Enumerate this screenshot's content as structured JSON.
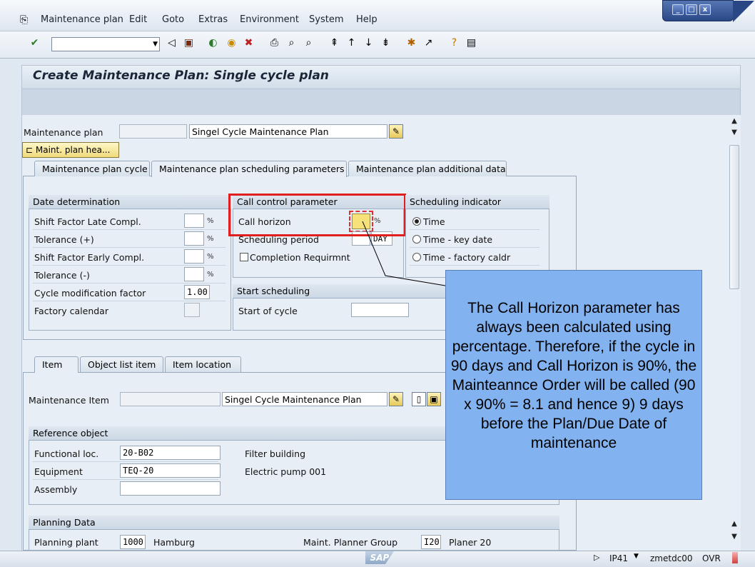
{
  "menu": {
    "items": [
      "Maintenance plan",
      "Edit",
      "Goto",
      "Extras",
      "Environment",
      "System",
      "Help"
    ]
  },
  "window_controls": {
    "minimize": "_",
    "maximize": "□",
    "close": "x"
  },
  "toolbar": {
    "command_value": ""
  },
  "header": {
    "title": "Create Maintenance Plan: Single cycle plan"
  },
  "plan": {
    "label": "Maintenance plan",
    "number": "",
    "description": "Singel Cycle Maintenance Plan",
    "header_button": "Maint. plan hea..."
  },
  "tabs": [
    "Maintenance plan cycle",
    "Maintenance plan scheduling parameters",
    "Maintenance plan additional data"
  ],
  "date_determination": {
    "title": "Date determination",
    "rows": [
      {
        "label": "Shift Factor Late Compl.",
        "value": "",
        "unit": "%"
      },
      {
        "label": "Tolerance (+)",
        "value": "",
        "unit": "%"
      },
      {
        "label": "Shift Factor Early Compl.",
        "value": "",
        "unit": "%"
      },
      {
        "label": "Tolerance (-)",
        "value": "",
        "unit": "%"
      },
      {
        "label": "Cycle modification factor",
        "value": "1.00",
        "unit": ""
      },
      {
        "label": "Factory calendar",
        "value": "",
        "unit": ""
      }
    ]
  },
  "call_control": {
    "title": "Call control parameter",
    "call_horizon_label": "Call horizon",
    "call_horizon_value": "",
    "call_horizon_unit": "%",
    "scheduling_period_label": "Scheduling period",
    "scheduling_period_unit": "DAY",
    "completion_label": "Completion Requirmnt"
  },
  "scheduling_indicator": {
    "title": "Scheduling indicator",
    "options": [
      "Time",
      "Time - key date",
      "Time - factory caldr"
    ],
    "selected": "Time"
  },
  "start_scheduling": {
    "title": "Start scheduling",
    "start_label": "Start of cycle",
    "start_value": ""
  },
  "item_tabs": [
    "Item",
    "Object list item",
    "Item location"
  ],
  "item": {
    "label": "Maintenance Item",
    "number": "",
    "description": "Singel Cycle Maintenance Plan"
  },
  "reference_object": {
    "title": "Reference object",
    "rows": [
      {
        "label": "Functional loc.",
        "value": "20-B02",
        "desc": "Filter building"
      },
      {
        "label": "Equipment",
        "value": "TEQ-20",
        "desc": "Electric pump 001"
      },
      {
        "label": "Assembly",
        "value": "",
        "desc": ""
      }
    ]
  },
  "planning_data": {
    "title": "Planning Data",
    "plant_label": "Planning plant",
    "plant_value": "1000",
    "plant_desc": "Hamburg",
    "group_label": "Maint. Planner Group",
    "group_value": "I20",
    "group_desc": "Planer 20"
  },
  "status": {
    "transaction": "IP41",
    "server": "zmetdc00",
    "mode": "OVR",
    "logo": "SAP"
  },
  "callout": {
    "text": "The Call Horizon parameter has always been calculated using percentage. Therefore, if the cycle in 90 days and Call Horizon is 90%, the Mainteannce Order will be called (90 x 90% = 8.1 and hence 9) 9 days before the Plan/Due Date of maintenance"
  },
  "colors": {
    "callout_bg": "#82b3f0",
    "highlight": "#e02020",
    "title_bar": "#2a4785"
  }
}
